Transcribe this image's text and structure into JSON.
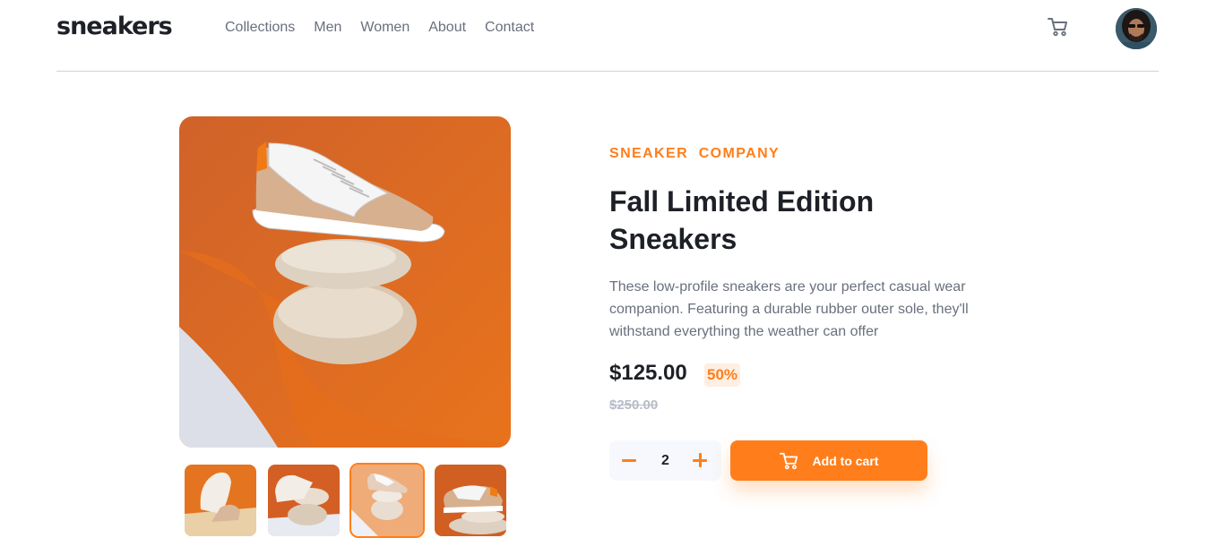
{
  "brand": {
    "logo": "sneakers"
  },
  "nav": {
    "items": [
      "Collections",
      "Men",
      "Women",
      "About",
      "Contact"
    ]
  },
  "header": {
    "cart_icon": "cart-icon",
    "avatar_icon": "avatar"
  },
  "product": {
    "company": "SNEAKER  COMPANY",
    "title": "Fall Limited Edition Sneakers",
    "description": "These low-profile sneakers are your perfect casual wear companion. Featuring a durable rubber outer sole, they'll withstand everything the weather can offer",
    "price": "$125.00",
    "discount": "50%",
    "old_price": "$250.00"
  },
  "quantity": {
    "value": "2"
  },
  "actions": {
    "add_to_cart": "Add to cart"
  },
  "gallery": {
    "thumbnail_count": 4,
    "active_thumbnail": 3
  },
  "colors": {
    "accent": "#ff7e1b",
    "accent_pale": "#ffeee2",
    "text_dark": "#1d2026",
    "text_muted": "#69707d",
    "text_faint": "#b6bcc8",
    "qty_bg": "#f6f8fd"
  }
}
